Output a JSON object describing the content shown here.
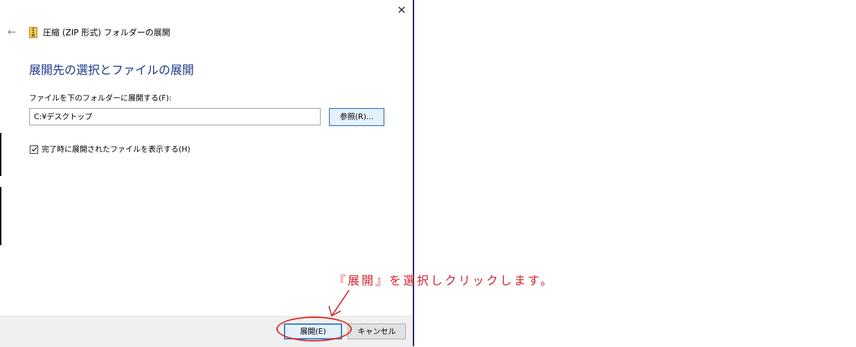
{
  "window": {
    "close_symbol": "✕",
    "back_symbol": "←",
    "title": "圧縮 (ZIP 形式) フォルダーの展開"
  },
  "main": {
    "heading": "展開先の選択とファイルの展開",
    "destination_label": "ファイルを下のフォルダーに展開する(F):",
    "destination_value": "C:¥デスクトップ",
    "browse_label": "参照(R)...",
    "show_files_checked": true,
    "show_files_label": "完了時に展開されたファイルを表示する(H)"
  },
  "footer": {
    "extract_label": "展開(E)",
    "cancel_label": "キャンセル"
  },
  "annotation": {
    "text": "『展開』を選択しクリックします。"
  },
  "colors": {
    "heading": "#1e3a8a",
    "annotation": "#d8242e",
    "button_border": "#2a6cb8"
  }
}
